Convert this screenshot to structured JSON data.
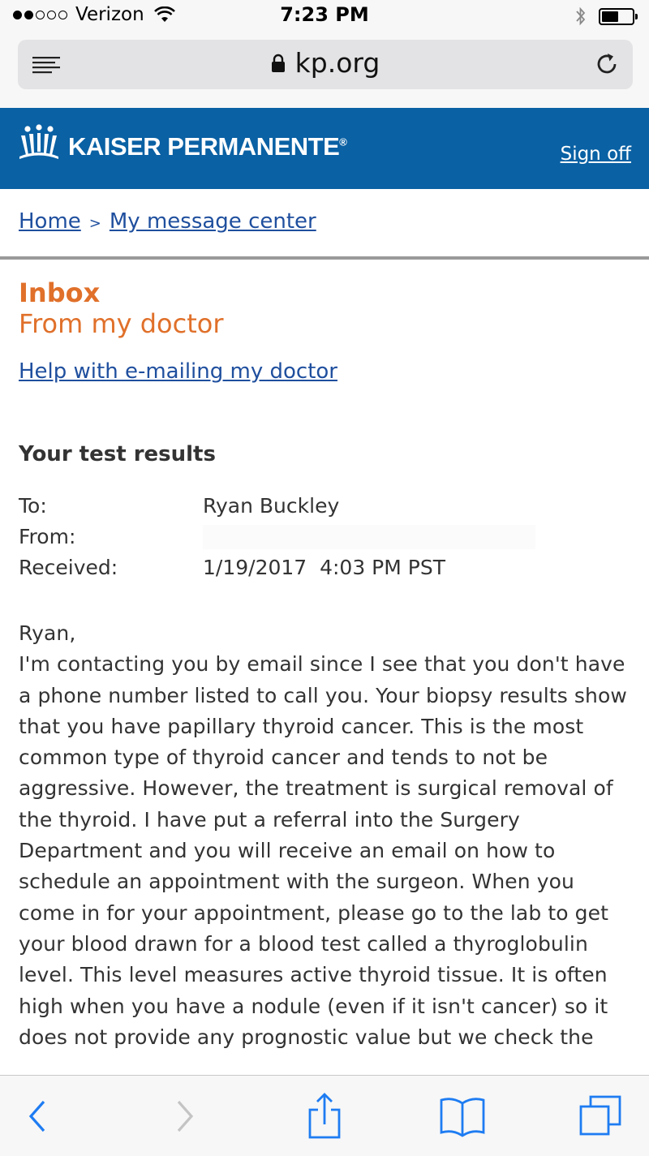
{
  "status_bar": {
    "carrier": "Verizon",
    "time": "7:23 PM",
    "signal_bars_filled": 2,
    "signal_bars_total": 5
  },
  "browser": {
    "url": "kp.org"
  },
  "header": {
    "brand": "KAISER PERMANENTE",
    "brand_mark": "®",
    "sign_off": "Sign off",
    "background_color": "#0a61a4"
  },
  "breadcrumb": {
    "home": "Home",
    "separator": ">",
    "current": "My message center"
  },
  "inbox": {
    "title": "Inbox",
    "subtitle": "From my doctor",
    "help_link": "Help with e-mailing my doctor",
    "accent_color": "#e0702a"
  },
  "message": {
    "subject": "Your test results",
    "to_label": "To:",
    "to_value": "Ryan Buckley",
    "from_label": "From:",
    "from_value": "",
    "received_label": "Received:",
    "received_value": "1/19/2017  4:03 PM PST",
    "greeting": "Ryan,",
    "body": "I'm contacting you by email since I see that you don't have a phone number listed to call you. Your biopsy results show that you have papillary thyroid cancer. This is the most common type of thyroid cancer and tends to not be aggressive. However, the treatment is surgical removal of the thyroid. I have put a referral into the Surgery Department and you will receive an email on how to schedule an appointment with the surgeon. When you come in for your appointment, please go to the lab to get your blood drawn for a blood test called a thyroglobulin level. This level measures active thyroid tissue. It is often high when you have a nodule (even if it isn't cancer) so it does not provide any prognostic value but we check the"
  },
  "toolbar": {
    "icons": [
      "back-icon",
      "forward-icon",
      "share-icon",
      "bookmarks-icon",
      "tabs-icon"
    ]
  }
}
